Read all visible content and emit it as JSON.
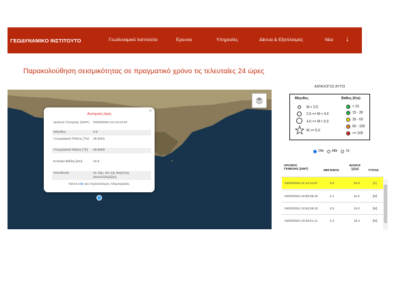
{
  "nav": {
    "brand": "ΓΕΩΔΥΝΑΜΙΚΟ ΙΝΣΤΙΤΟΥΤΟ",
    "items": [
      "Γεωδυναμικό Ινστιτούτο",
      "Έρευνα",
      "Υπηρεσίες",
      "Δίκτυα & Εξοπλισμός",
      "Νέα"
    ],
    "arrow": "↓",
    "color": "#b8290c"
  },
  "page_title": "Παρακολούθηση σεισμικότητας σε πραγματικό χρόνο τις τελευταίες 24 ώρες",
  "popup": {
    "close": "×",
    "title": "Αυτόματη λύση",
    "rows": [
      {
        "label": "Χρόνος Γέννησης (GMT)",
        "value": "04/03/2024 11:14:14.87"
      },
      {
        "label": "Μέγεθος",
        "value": "3.5"
      },
      {
        "label": "Γεωγραφικό Πλάτος [°N]",
        "value": "35.8301"
      },
      {
        "label": "Γεωγραφικό Μήκος [°E]",
        "value": "28.9565"
      },
      {
        "label": "Εστιακό Βάθος [km]",
        "value": "10.0"
      },
      {
        "label": "Τοποθεσία",
        "value": "41 Χλμ. ΝΑ της Μεγίστης (Καστελλορίζου)"
      }
    ],
    "more_prefix": "Κάντε",
    "more_link": "κλικ",
    "more_suffix": "για περισσότερες πληροφορίες"
  },
  "legend": {
    "title": "ΚΑΤΑΛΟΓΟΣ ΑΥΤΟΙ",
    "magnitude_header": "Μέγεθος",
    "depth_header": "Βάθος (Km)",
    "magnitudes": [
      "M < 2.5",
      "2.5 <= M < 4.0",
      "4.0 <= M < 5.0",
      "M >= 5.0"
    ],
    "depths": [
      {
        "label": "< 15",
        "color": "#1fbf4a"
      },
      {
        "label": "15 - 30",
        "color": "#1fbf4a"
      },
      {
        "label": "30 - 60",
        "color": "#f5e50a"
      },
      {
        "label": "60 - 100",
        "color": "#f08a1e"
      },
      {
        "label": ">= 100",
        "color": "#e8221d"
      }
    ]
  },
  "periods": [
    {
      "label": "24h",
      "selected": true
    },
    {
      "label": "48h",
      "selected": false
    },
    {
      "label": "7d",
      "selected": false
    }
  ],
  "table": {
    "headers": [
      "ΧΡΟΝΟΣ ΓΕΝΕΣΗΣ (GMT)",
      "ΜΕΓΕΘΟΣ",
      "ΒΑΘΟΣ (χλμ)",
      "ΤΥΠΟΣ"
    ],
    "rows": [
      {
        "time": "04/03/2024 11:14:14.87",
        "mag": "3.5",
        "depth": "10.0",
        "type": "[A]",
        "highlight": true
      },
      {
        "time": "04/03/2024 10:55:08.44",
        "mag": "2.1",
        "depth": "11.3",
        "type": "[M]",
        "highlight": false
      },
      {
        "time": "04/03/2024 10:54:28.33",
        "mag": "2.5",
        "depth": "12.0",
        "type": "[M]",
        "highlight": false
      },
      {
        "time": "04/03/2024 10:29:41.11",
        "mag": "1.3",
        "depth": "19.4",
        "type": "[M]",
        "highlight": false
      }
    ]
  }
}
